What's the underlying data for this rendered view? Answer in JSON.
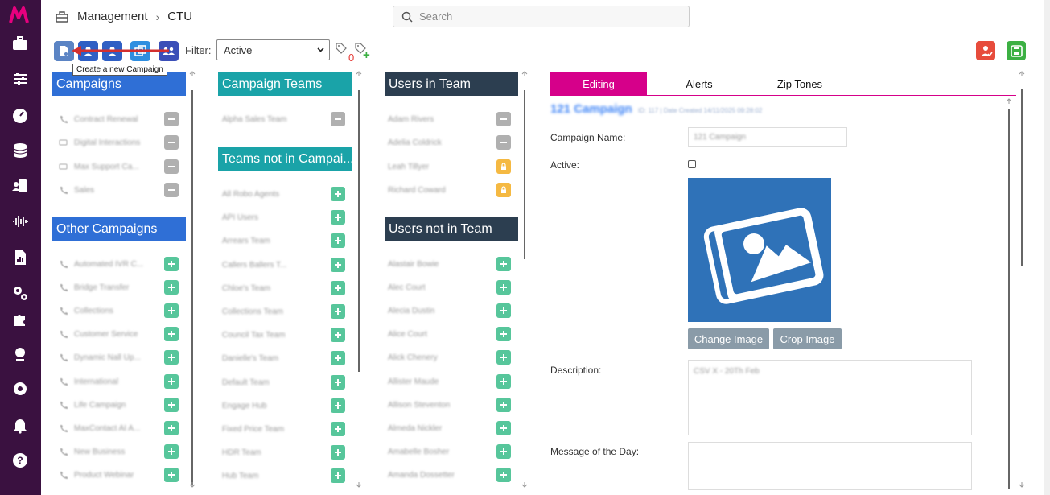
{
  "breadcrumb": {
    "root": "Management",
    "separator": "›",
    "current": "CTU"
  },
  "search": {
    "placeholder": "Search"
  },
  "toolbar": {
    "filter_label": "Filter:",
    "filter_value": "Active",
    "tag_count": "0",
    "tag_plus": "+",
    "tooltip": "Create a new Campaign"
  },
  "columns": {
    "campaigns": {
      "title": "Campaigns",
      "items": [
        "Contract Renewal",
        "Digital Interactions",
        "Max Support Ca...",
        "Sales"
      ]
    },
    "other_campaigns": {
      "title": "Other Campaigns",
      "items": [
        "Automated IVR C...",
        "Bridge Transfer",
        "Collections",
        "Customer Service",
        "Dynamic Nall Up...",
        "International",
        "Life Campaign",
        "MaxContact AI A...",
        "New Business",
        "Product Webinar"
      ]
    },
    "campaign_teams": {
      "title": "Campaign Teams",
      "items": [
        "Alpha Sales Team"
      ]
    },
    "teams_not_in_campaign": {
      "title": "Teams not in Campai...",
      "items": [
        "All Robo Agents",
        "API Users",
        "Arrears Team",
        "Callers Ballers T...",
        "Chloe's Team",
        "Collections Team",
        "Council Tax Team",
        "Danielle's Team",
        "Default Team",
        "Engage Hub",
        "Fixed Price Team",
        "HDR Team",
        "Hub Team"
      ]
    },
    "users_in_team": {
      "title": "Users in Team",
      "items": [
        "Adam Rivers",
        "Adelia Coldrick",
        "Leah Tillyer",
        "Richard Coward"
      ]
    },
    "users_not_in_team": {
      "title": "Users not in Team",
      "items": [
        "Alastair Bowie",
        "Alec Court",
        "Alecia Dustin",
        "Alice Court",
        "Alick Chenery",
        "Allister Maude",
        "Allison Steventon",
        "Almeda Nickler",
        "Amabelle Bosher",
        "Amanda Dossetter"
      ]
    }
  },
  "tabs": [
    "Editing",
    "Alerts",
    "Zip Tones"
  ],
  "detail": {
    "campaign_title": "121 Campaign",
    "campaign_meta": "ID: 117 | Date Created 14/11/2025 09:28:02",
    "name_label": "Campaign Name:",
    "name_value": "121 Campaign",
    "active_label": "Active:",
    "change_image": "Change Image",
    "crop_image": "Crop Image",
    "description_label": "Description:",
    "description_value": "CSV X - 20Th Feb",
    "motd_label": "Message of the Day:"
  },
  "colors": {
    "nav_bg": "#3a1140",
    "brand_accent": "#d6008a",
    "campaigns_header": "#2f6fd6",
    "teams_header": "#1aa3a8",
    "users_header": "#2c3e50",
    "plus_green": "#57c69b"
  }
}
